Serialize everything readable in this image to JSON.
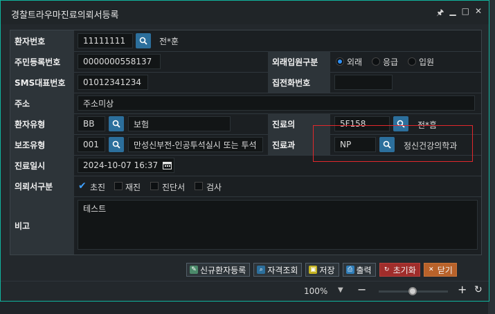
{
  "window": {
    "title": "경찰트라우마진료의뢰서등록"
  },
  "patient": {
    "label": "환자번호",
    "number": "11111111",
    "name": "전*훈"
  },
  "resident": {
    "label": "주민등록번호",
    "value": "0000000558137"
  },
  "visit_type": {
    "label": "외래입원구분",
    "options": [
      "외래",
      "응급",
      "입원"
    ],
    "selected": "외래"
  },
  "sms": {
    "label": "SMS대표번호",
    "value": "01012341234"
  },
  "home_phone": {
    "label": "집전화번호",
    "value": ""
  },
  "address": {
    "label": "주소",
    "value": "주소미상"
  },
  "patient_type": {
    "label": "환자유형",
    "code": "BB",
    "name": "보험"
  },
  "doctor": {
    "label": "진료의",
    "code": "5F158",
    "name": "전*흠"
  },
  "aux_type": {
    "label": "보조유형",
    "code": "001",
    "name": "만성신부전-인공투석실시 또는 투석"
  },
  "department": {
    "label": "진료과",
    "code": "NP",
    "name": "정신건강의학과"
  },
  "date": {
    "label": "진료일시",
    "value": "2024-10-07 16:37"
  },
  "referral_type": {
    "label": "의뢰서구분",
    "options": [
      {
        "label": "초진",
        "checked": true
      },
      {
        "label": "재진",
        "checked": false
      },
      {
        "label": "진단서",
        "checked": false
      },
      {
        "label": "검사",
        "checked": false
      }
    ]
  },
  "note": {
    "label": "비고",
    "value": "테스트"
  },
  "actions": {
    "new_patient": "신규환자등록",
    "eligibility": "자격조회",
    "save": "저장",
    "print": "출력",
    "reset": "초기화",
    "close": "닫기"
  },
  "statusbar": {
    "zoom": "100%",
    "zoom_level": 0.5
  },
  "colors": {
    "accent": "#10b59f",
    "search_button": "#2c6f9c",
    "highlight": "#e2282c"
  }
}
